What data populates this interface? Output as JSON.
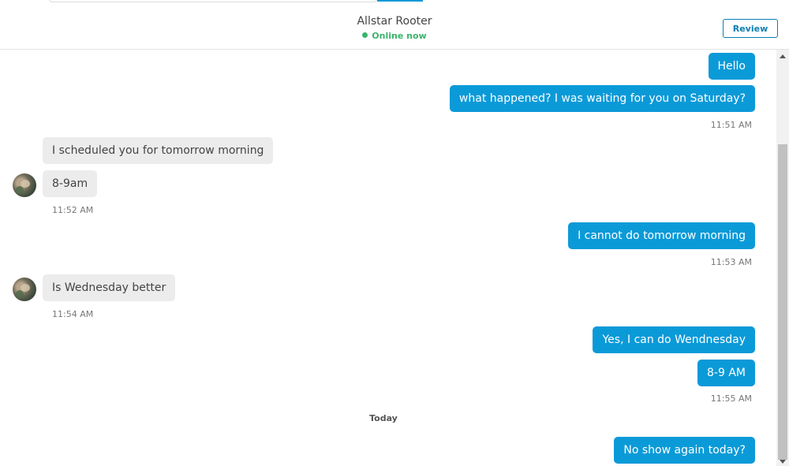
{
  "header": {
    "contact_name": "Allstar Rooter",
    "status": "Online now",
    "review_label": "Review"
  },
  "colors": {
    "outgoing_bubble": "#0b9ad8",
    "incoming_bubble": "#ececec",
    "online_green": "#3bb36b",
    "review_border": "#0b7fb3"
  },
  "icons": {
    "status_dot": "online-dot-icon",
    "avatar": "contact-avatar"
  },
  "messages": [
    {
      "direction": "out",
      "text": "Hello"
    },
    {
      "direction": "out",
      "text": "what happened? I was waiting for you on Saturday?"
    },
    {
      "direction": "time_out",
      "text": "11:51 AM"
    },
    {
      "direction": "in",
      "text": "I scheduled you for tomorrow morning"
    },
    {
      "direction": "in",
      "text": "8-9am"
    },
    {
      "direction": "time_in",
      "text": "11:52 AM"
    },
    {
      "direction": "out",
      "text": "I cannot do tomorrow morning"
    },
    {
      "direction": "time_out",
      "text": "11:53 AM"
    },
    {
      "direction": "in",
      "text": "Is Wednesday better"
    },
    {
      "direction": "time_in",
      "text": "11:54 AM"
    },
    {
      "direction": "out",
      "text": "Yes, I can do Wendnesday"
    },
    {
      "direction": "out",
      "text": "8-9 AM"
    },
    {
      "direction": "time_out",
      "text": "11:55 AM"
    },
    {
      "direction": "divider",
      "text": "Today"
    },
    {
      "direction": "out",
      "text": "No show again today?"
    }
  ]
}
